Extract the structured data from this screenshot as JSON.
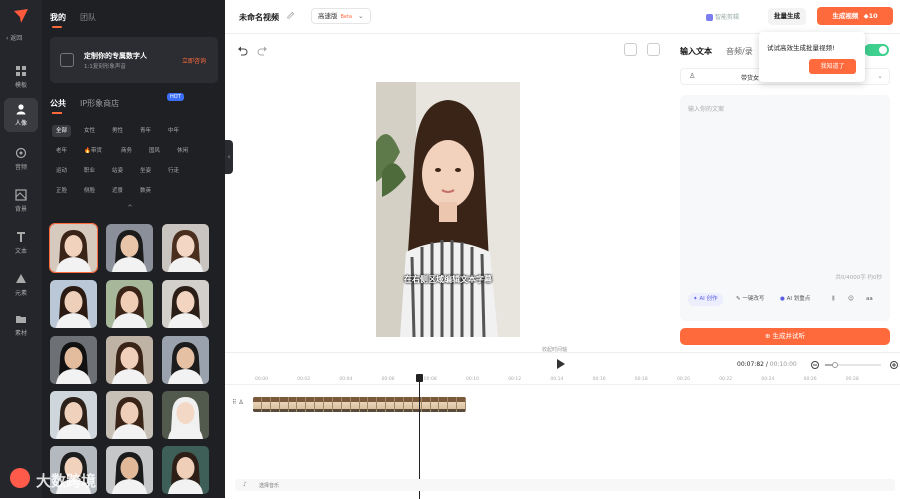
{
  "rail": {
    "back": "‹ 返回",
    "items": [
      {
        "label": "模板",
        "icon": "template-icon"
      },
      {
        "label": "人像",
        "icon": "person-icon"
      },
      {
        "label": "音频",
        "icon": "audio-icon"
      },
      {
        "label": "背景",
        "icon": "background-icon"
      },
      {
        "label": "文本",
        "icon": "text-icon"
      },
      {
        "label": "元素",
        "icon": "element-icon"
      },
      {
        "label": "素材",
        "icon": "folder-icon"
      }
    ]
  },
  "panel": {
    "tabs": [
      "我的",
      "团队"
    ],
    "promo": {
      "title": "定制你的专属数字人",
      "subtitle": "1:1复刻形象声音",
      "cta": "立即咨询"
    },
    "subtabs": [
      "公共",
      "IP形象商店"
    ],
    "hot": "HOT",
    "categories": [
      "全部",
      "女性",
      "男性",
      "青年",
      "中年",
      "老年",
      "🔥带货",
      "商务",
      "国风",
      "休闲",
      "运动",
      "职业",
      "站姿",
      "坐姿",
      "行走",
      "正脸",
      "侧脸",
      "近景",
      "数英"
    ],
    "collapse": "^"
  },
  "watermark": "大数跨境",
  "topbar": {
    "title": "未命名视频",
    "version": "高速版",
    "beta": "Beta",
    "smart_edit": "智能剪辑",
    "batch": "批量生成",
    "generate": "生成视频",
    "credits": "10"
  },
  "tooltip": {
    "text": "试试高效生成批量视频!",
    "button": "我知道了"
  },
  "canvas": {
    "subtitle": "在右侧区域编辑文本字幕"
  },
  "right": {
    "tabs": [
      "输入文本",
      "音频/录"
    ],
    "voice_name": "带货女",
    "placeholder": "输入你的文案",
    "count": "共0/4000字 约0秒",
    "tools": [
      "AI 创作",
      "一键改写",
      "AI 划重点"
    ],
    "synth": "生成并试听"
  },
  "timeline": {
    "hint": "收起时间轴",
    "time_current": "00:07:82",
    "time_total": "00:10:00",
    "ticks": [
      "00:00",
      "00:02",
      "00:04",
      "00:06",
      "00:08",
      "00:10",
      "00:12",
      "00:14",
      "00:16",
      "00:18",
      "00:20",
      "00:22",
      "00:24",
      "00:26",
      "00:28"
    ],
    "music": "选择音乐"
  }
}
